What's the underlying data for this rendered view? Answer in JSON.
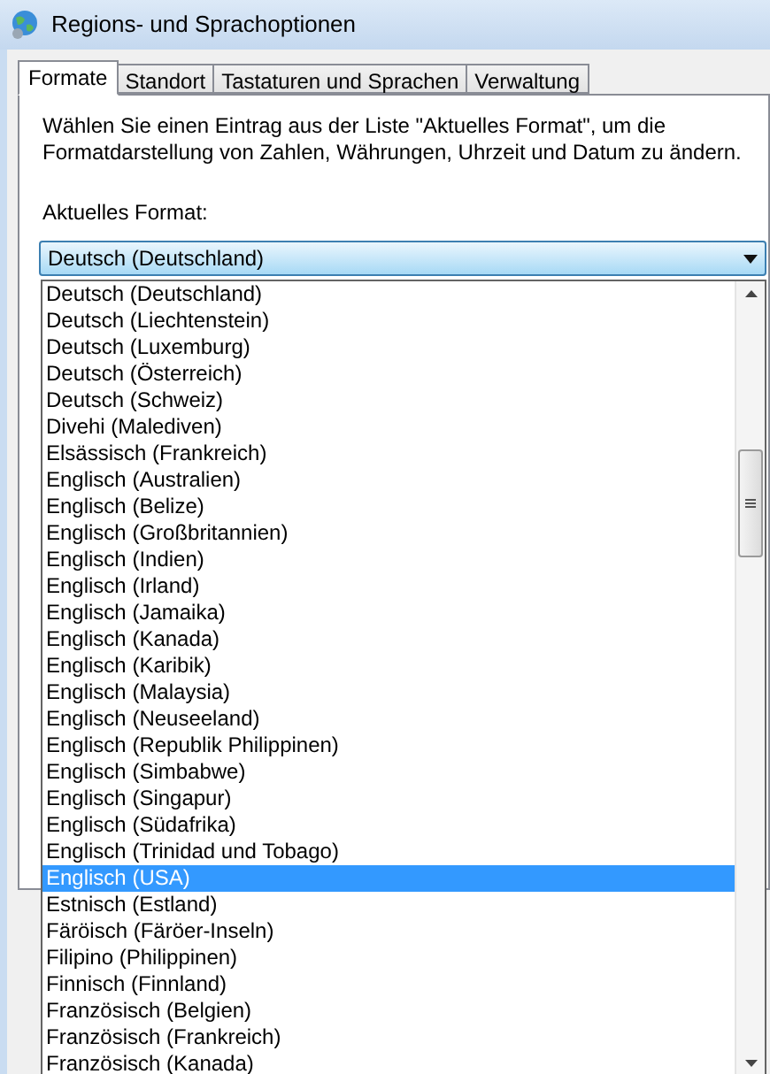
{
  "window": {
    "title": "Regions- und Sprachoptionen"
  },
  "tabs": [
    {
      "label": "Formate",
      "selected": true
    },
    {
      "label": "Standort",
      "selected": false
    },
    {
      "label": "Tastaturen und Sprachen",
      "selected": false
    },
    {
      "label": "Verwaltung",
      "selected": false
    }
  ],
  "instructions": "Wählen Sie einen Eintrag aus der Liste \"Aktuelles Format\", um die Formatdarstellung von Zahlen, Währungen, Uhrzeit und Datum zu ändern.",
  "format_label": "Aktuelles Format:",
  "format_combo": {
    "value": "Deutsch (Deutschland)"
  },
  "dropdown_items": [
    {
      "label": "Deutsch (Deutschland)",
      "selected": false
    },
    {
      "label": "Deutsch (Liechtenstein)",
      "selected": false
    },
    {
      "label": "Deutsch (Luxemburg)",
      "selected": false
    },
    {
      "label": "Deutsch (Österreich)",
      "selected": false
    },
    {
      "label": "Deutsch (Schweiz)",
      "selected": false
    },
    {
      "label": "Divehi (Malediven)",
      "selected": false
    },
    {
      "label": "Elsässisch (Frankreich)",
      "selected": false
    },
    {
      "label": "Englisch (Australien)",
      "selected": false
    },
    {
      "label": "Englisch (Belize)",
      "selected": false
    },
    {
      "label": "Englisch (Großbritannien)",
      "selected": false
    },
    {
      "label": "Englisch (Indien)",
      "selected": false
    },
    {
      "label": "Englisch (Irland)",
      "selected": false
    },
    {
      "label": "Englisch (Jamaika)",
      "selected": false
    },
    {
      "label": "Englisch (Kanada)",
      "selected": false
    },
    {
      "label": "Englisch (Karibik)",
      "selected": false
    },
    {
      "label": "Englisch (Malaysia)",
      "selected": false
    },
    {
      "label": "Englisch (Neuseeland)",
      "selected": false
    },
    {
      "label": "Englisch (Republik Philippinen)",
      "selected": false
    },
    {
      "label": "Englisch (Simbabwe)",
      "selected": false
    },
    {
      "label": "Englisch (Singapur)",
      "selected": false
    },
    {
      "label": "Englisch (Südafrika)",
      "selected": false
    },
    {
      "label": "Englisch (Trinidad und Tobago)",
      "selected": false
    },
    {
      "label": "Englisch (USA)",
      "selected": true
    },
    {
      "label": "Estnisch (Estland)",
      "selected": false
    },
    {
      "label": "Färöisch (Färöer-Inseln)",
      "selected": false
    },
    {
      "label": "Filipino (Philippinen)",
      "selected": false
    },
    {
      "label": "Finnisch (Finnland)",
      "selected": false
    },
    {
      "label": "Französisch (Belgien)",
      "selected": false
    },
    {
      "label": "Französisch (Frankreich)",
      "selected": false
    },
    {
      "label": "Französisch (Kanada)",
      "selected": false
    }
  ]
}
